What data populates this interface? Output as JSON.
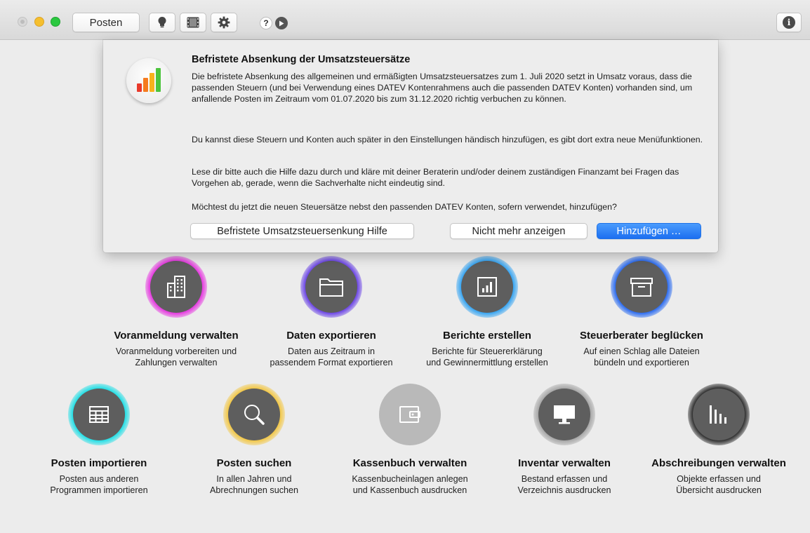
{
  "toolbar": {
    "posten_label": "Posten",
    "help_label": "?"
  },
  "dialog": {
    "title": "Befristete Absenkung der Umsatzsteuersätze",
    "paragraph1": "Die befristete Absenkung des allgemeinen und ermäßigten Umsatzsteuersatzes zum 1. Juli 2020 setzt in Umsatz voraus, dass die passenden Steuern (und bei Verwendung eines DATEV Kontenrahmens auch die passenden DATEV Konten) vorhanden sind, um anfallende Posten im Zeitraum vom 01.07.2020 bis zum 31.12.2020 richtig verbuchen zu können.",
    "paragraph2": "Du kannst diese Steuern und Konten auch später in den Einstellungen händisch hinzufügen, es gibt dort extra neue Menüfunktionen.",
    "paragraph3": "Lese dir bitte auch die Hilfe dazu durch und kläre mit deiner Beraterin und/oder deinem zuständigen Finanzamt bei Fragen das Vorgehen ab, gerade, wenn die Sachverhalte nicht eindeutig sind.",
    "paragraph4": "Möchtest du jetzt die neuen Steuersätze nebst den passenden DATEV Konten, sofern verwendet, hinzufügen?",
    "help_button": "Befristete Umsatzsteuersenkung Hilfe",
    "never_button": "Nicht mehr anzeigen",
    "add_button": "Hinzufügen …"
  },
  "tiles": [
    {
      "title": "Voranmeldung verwalten",
      "line1": "Voranmeldung vorbereiten und",
      "line2": "Zahlungen verwalten",
      "icon": "building-icon",
      "color": "#e63ce0"
    },
    {
      "title": "Daten exportieren",
      "line1": "Daten aus Zeitraum in",
      "line2": "passendem Format exportieren",
      "icon": "folder-icon",
      "color": "#7b4ae8"
    },
    {
      "title": "Berichte erstellen",
      "line1": "Berichte für Steuererklärung",
      "line2": "und Gewinnermittlung erstellen",
      "icon": "report-chart-icon",
      "color": "#3aa6f2"
    },
    {
      "title": "Steuerberater beglücken",
      "line1": "Auf einen Schlag alle Dateien",
      "line2": "bündeln und exportieren",
      "icon": "archive-box-icon",
      "color": "#2f6ef0"
    },
    {
      "title": "Posten importieren",
      "line1": "Posten aus anderen",
      "line2": "Programmen importieren",
      "icon": "table-grid-icon",
      "color": "#28e0e6"
    },
    {
      "title": "Posten suchen",
      "line1": "In allen Jahren und",
      "line2": "Abrechnungen suchen",
      "icon": "magnifier-icon",
      "color": "#f2c84a"
    },
    {
      "title": "Kassenbuch verwalten",
      "line1": "Kassenbucheinlagen anlegen",
      "line2": "und Kassenbuch ausdrucken",
      "icon": "wallet-icon",
      "color": "#c4c4c4"
    },
    {
      "title": "Inventar verwalten",
      "line1": "Bestand erfassen und",
      "line2": "Verzeichnis ausdrucken",
      "icon": "monitor-icon",
      "color": "#b0b0b0"
    },
    {
      "title": "Abschreibungen verwalten",
      "line1": "Objekte erfassen und",
      "line2": "Übersicht ausdrucken",
      "icon": "bars-declining-icon",
      "color": "#3a3a3a"
    }
  ]
}
